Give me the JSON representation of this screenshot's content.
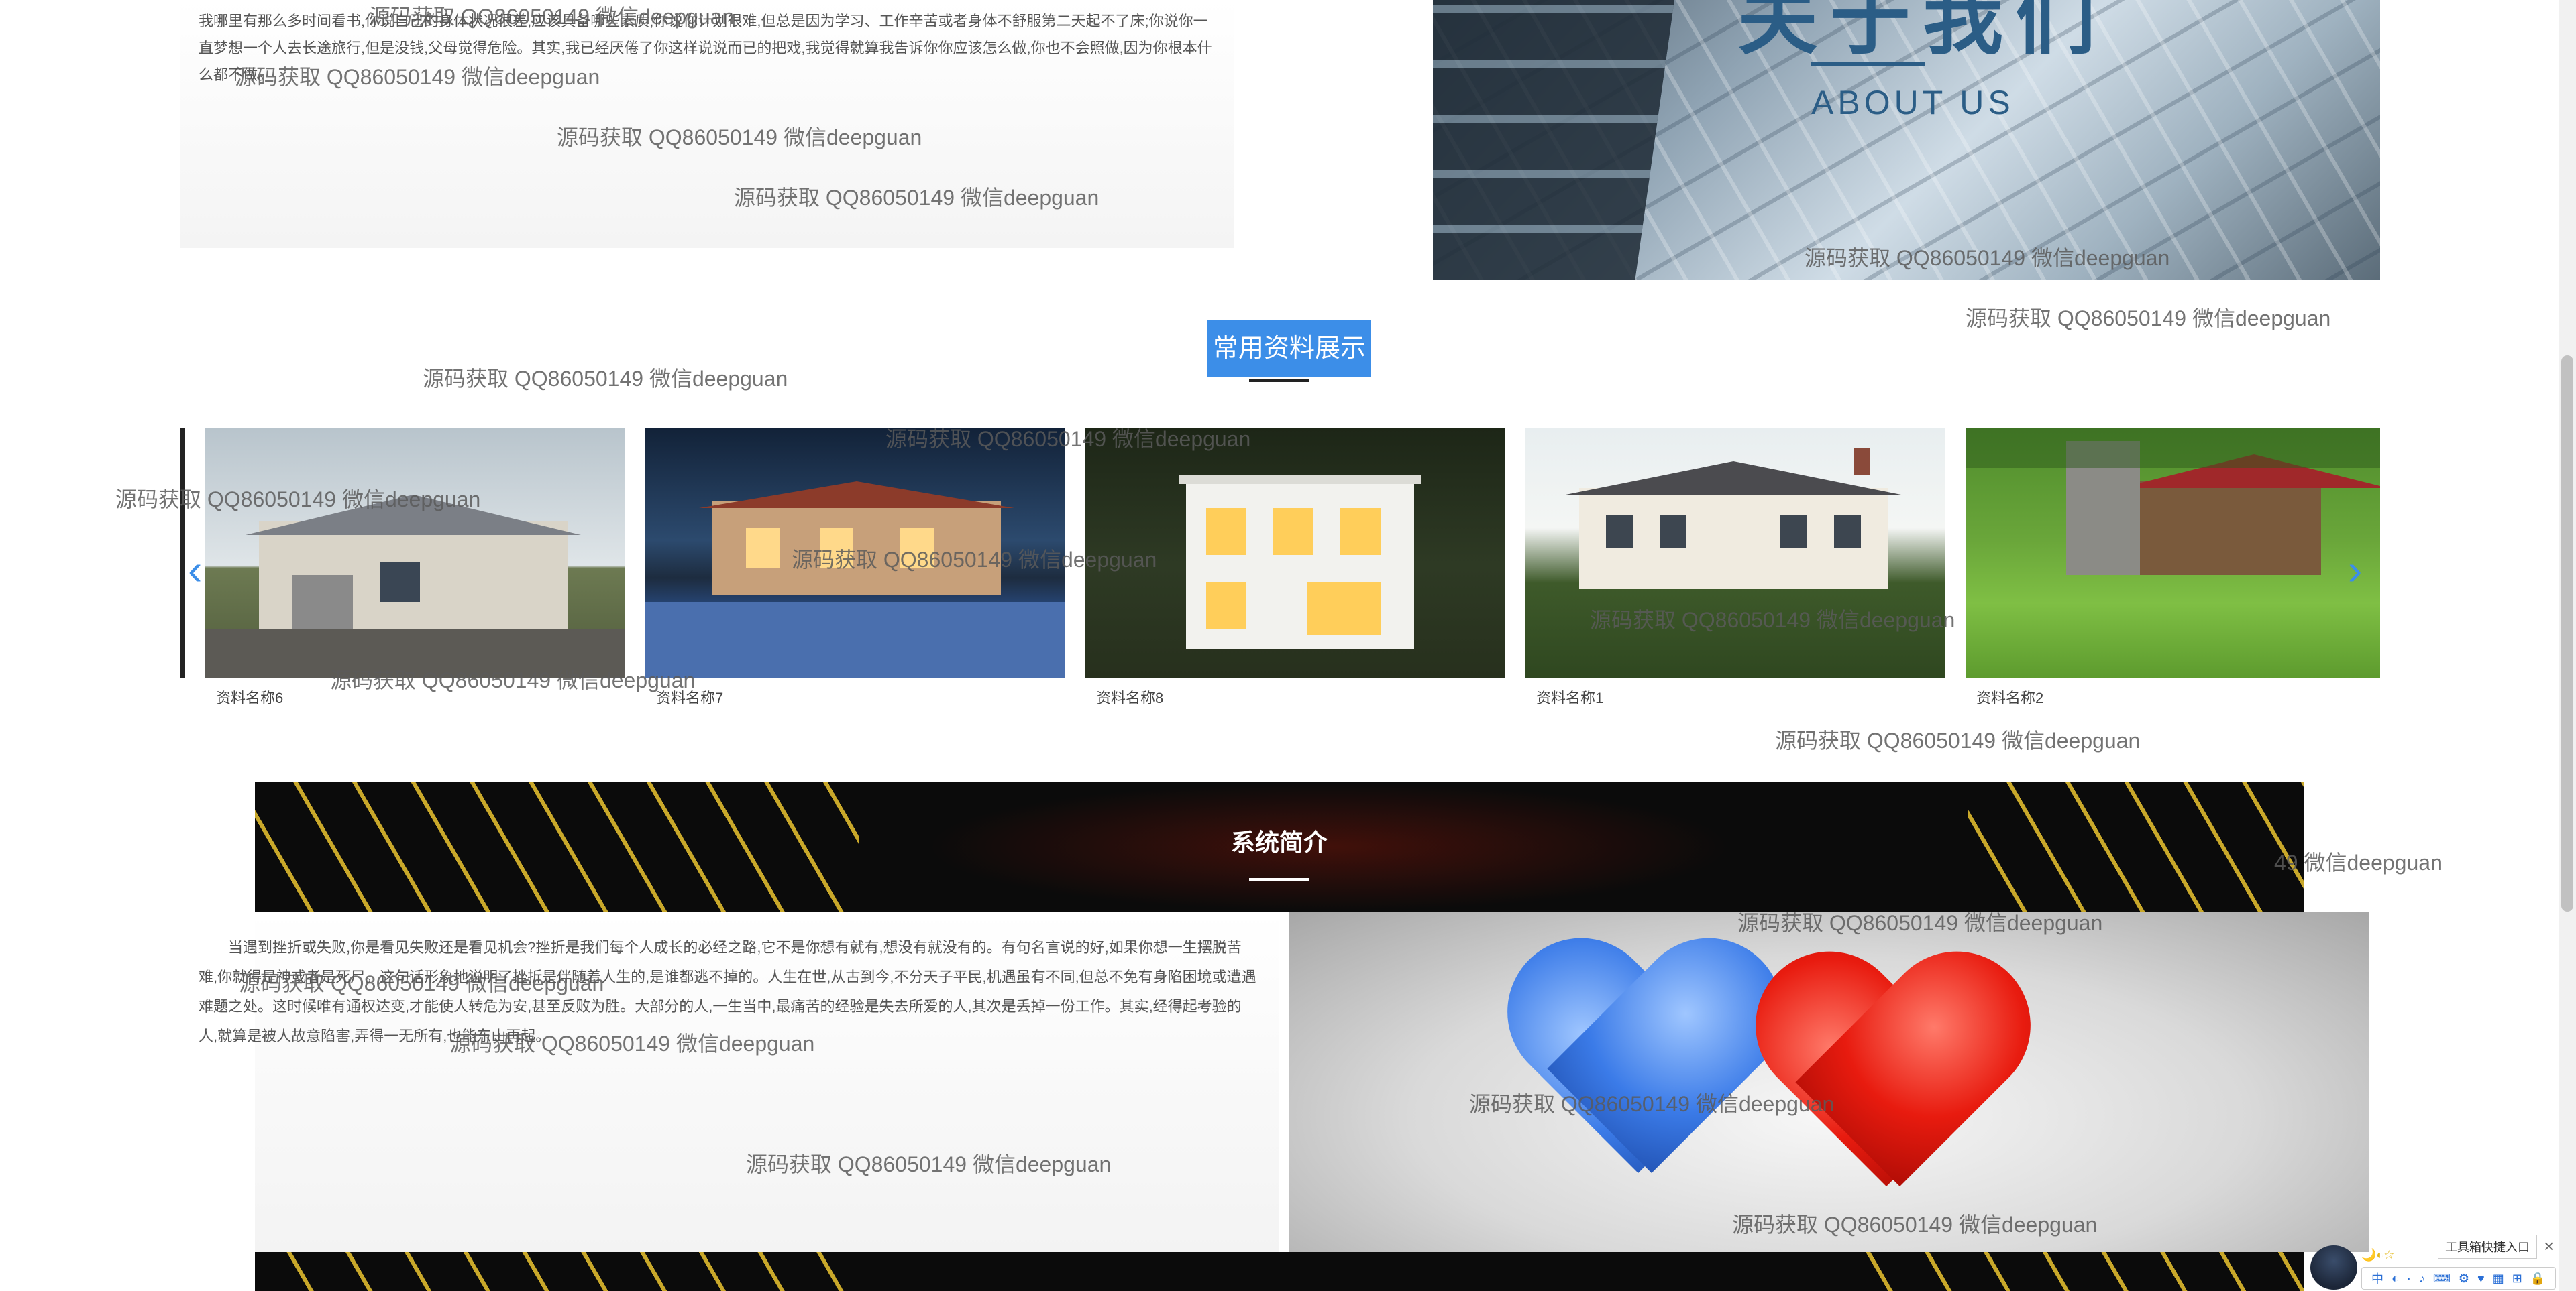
{
  "about": {
    "text": "我哪里有那么多时间看书,你说自己的身体状况很差,应该具备哪些素质;你说你计划很难,但总是因为学习、工作辛苦或者身体不舒服第二天起不了床;你说你一直梦想一个人去长途旅行,但是没钱,父母觉得危险。其实,我已经厌倦了你这样说说而已的把戏,我觉得就算我告诉你你应该怎么做,你也不会照做,因为你根本什么都不做。",
    "title_cn": "关于我们",
    "title_en": "ABOUT US"
  },
  "section_heading": "常用资料展示",
  "carousel": {
    "prev_label": "‹",
    "next_label": "›",
    "slides": [
      {
        "caption": "资料名称6"
      },
      {
        "caption": "资料名称7"
      },
      {
        "caption": "资料名称8"
      },
      {
        "caption": "资料名称1"
      },
      {
        "caption": "资料名称2"
      }
    ]
  },
  "intro": {
    "title": "系统简介",
    "text": "当遇到挫折或失败,你是看见失败还是看见机会?挫折是我们每个人成长的必经之路,它不是你想有就有,想没有就没有的。有句名言说的好,如果你想一生摆脱苦难,你就得是神或者是死尸。这句话形象地说明了挫折是伴随着人生的,是谁都逃不掉的。人生在世,从古到今,不分天子平民,机遇虽有不同,但总不免有身陷困境或遭遇难题之处。这时候唯有通权达变,才能使人转危为安,甚至反败为胜。大部分的人,一生当中,最痛苦的经验是失去所爱的人,其次是丢掉一份工作。其实,经得起考验的人,就算是被人故意陷害,弄得一无所有,也能东山再起。"
  },
  "watermark_text": "源码获取 QQ86050149 微信deepguan",
  "watermark_partial": "49 微信deepguan",
  "tool_entry_label": "工具箱快捷入口",
  "tool_close_label": "×",
  "ime": {
    "items": [
      "中",
      "◐",
      "·",
      "♪",
      "⌨",
      "⚙",
      "♥",
      "▦",
      "⊞",
      "🔒"
    ],
    "moon": "🌙◐☆"
  }
}
